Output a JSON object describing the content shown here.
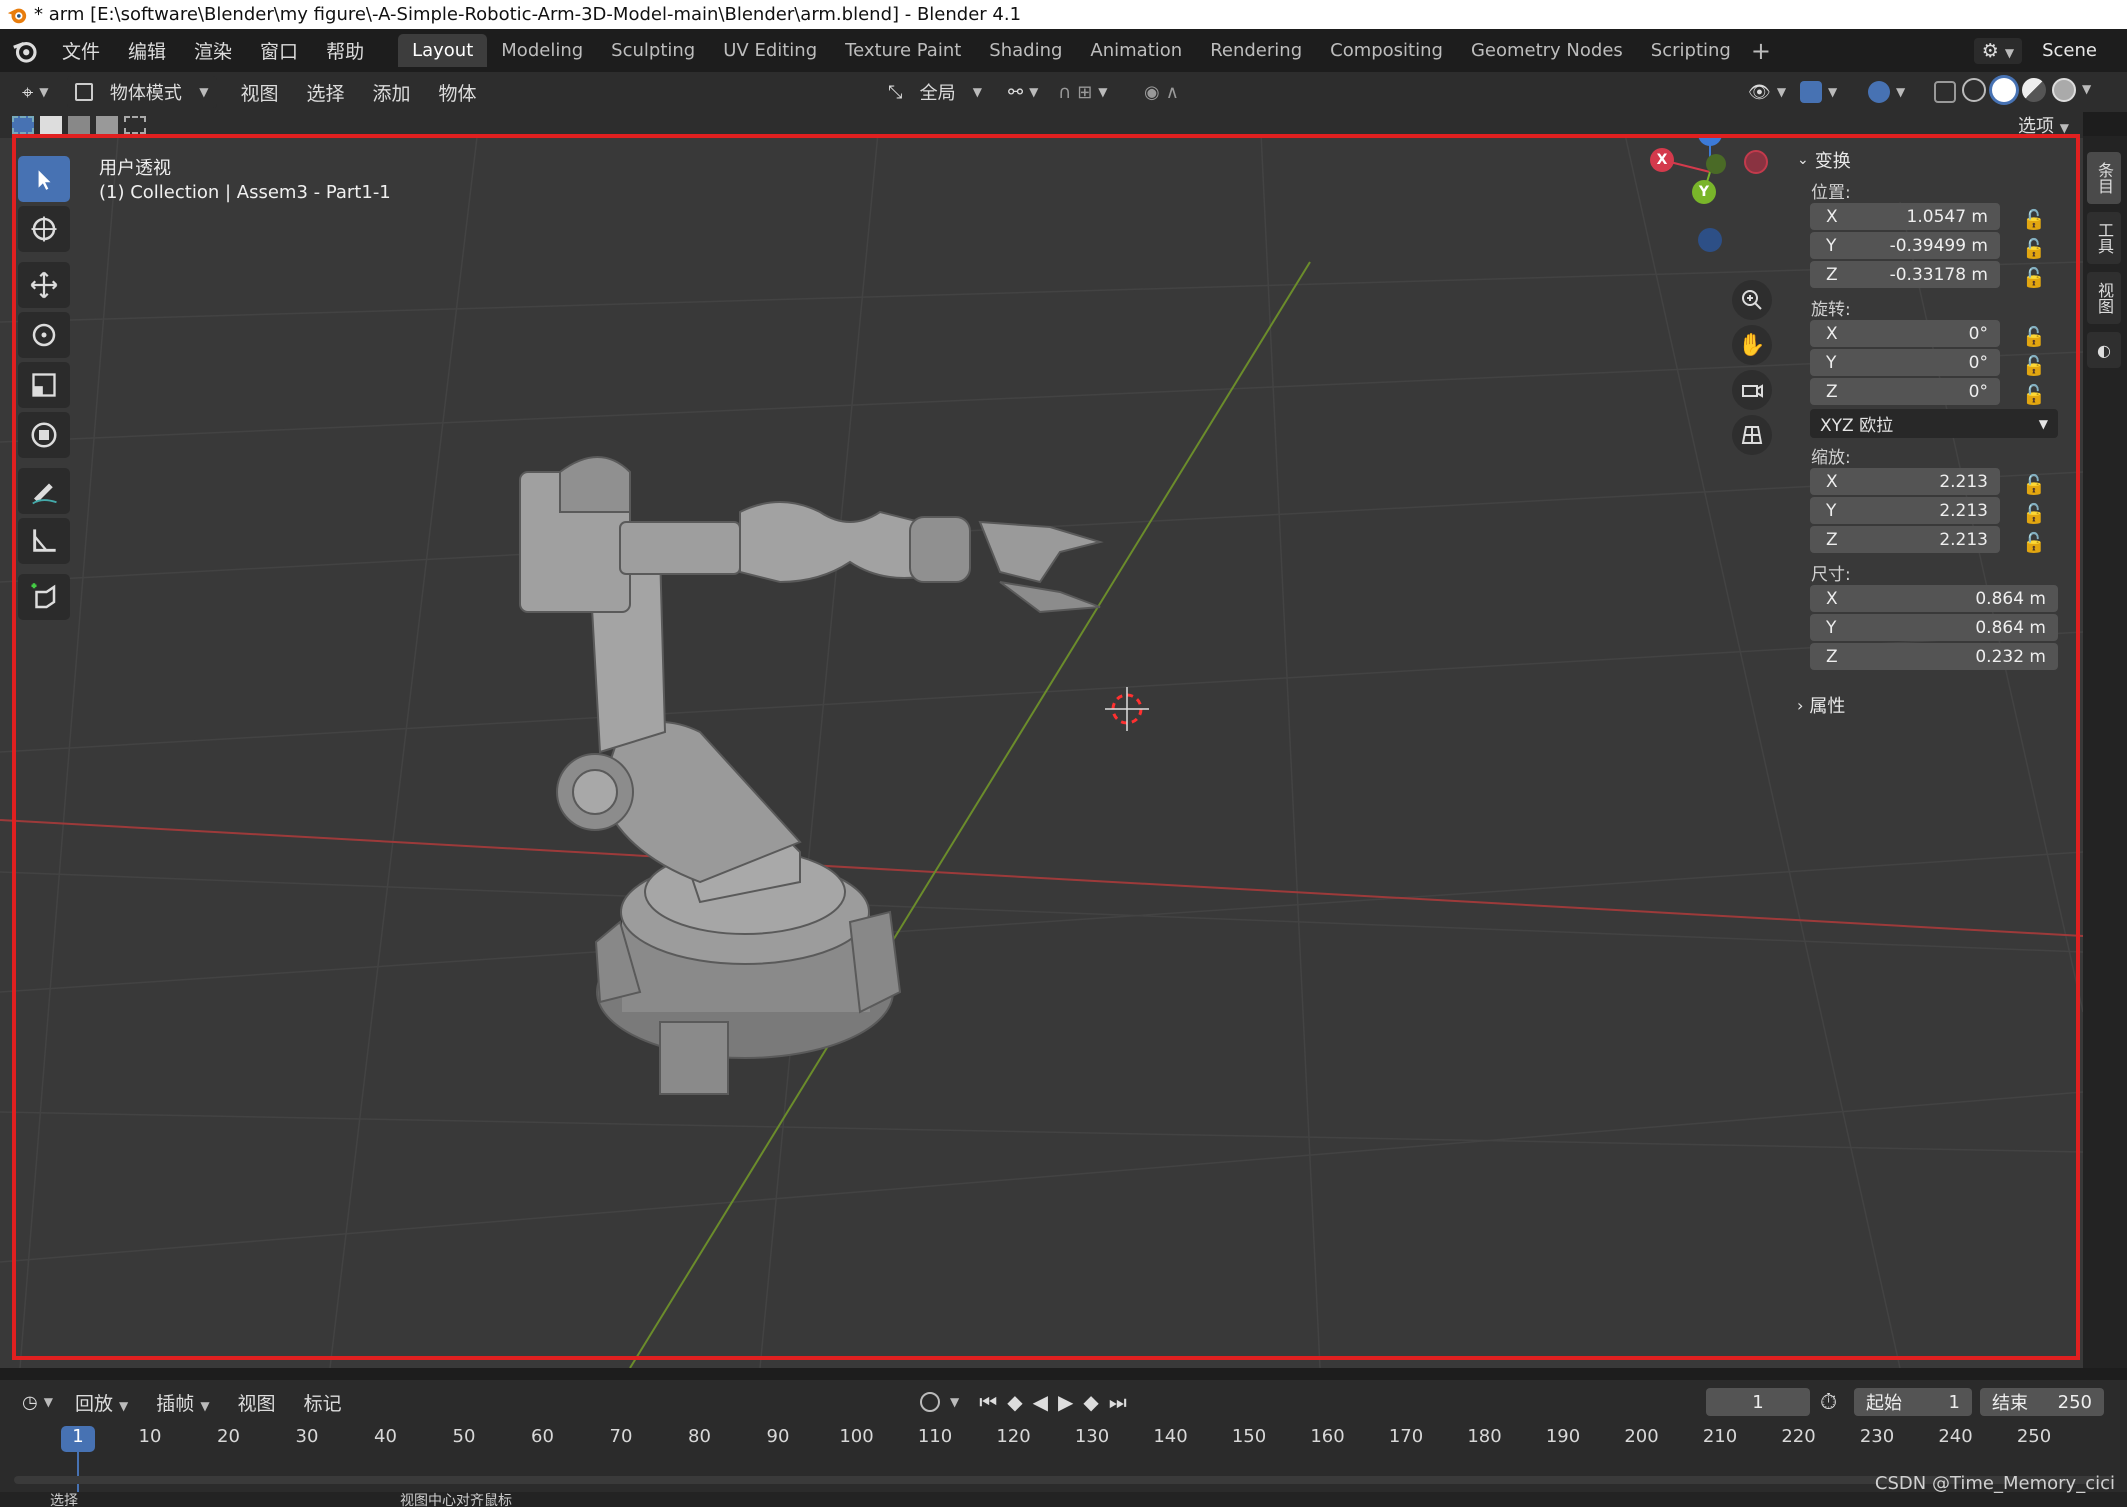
{
  "window": {
    "title": "* arm [E:\\software\\Blender\\my figure\\-A-Simple-Robotic-Arm-3D-Model-main\\Blender\\arm.blend] - Blender 4.1"
  },
  "menu": [
    "文件",
    "编辑",
    "渲染",
    "窗口",
    "帮助"
  ],
  "workspaces": [
    "Layout",
    "Modeling",
    "Sculpting",
    "UV Editing",
    "Texture Paint",
    "Shading",
    "Animation",
    "Rendering",
    "Compositing",
    "Geometry Nodes",
    "Scripting"
  ],
  "active_workspace": "Layout",
  "scene": {
    "name": "Scene"
  },
  "header": {
    "mode": "物体模式",
    "menus": [
      "视图",
      "选择",
      "添加",
      "物体"
    ],
    "orientation": "全局",
    "options": "选项"
  },
  "viewport": {
    "view_name": "用户透视",
    "collection_info": "(1) Collection | Assem3 - Part1-1",
    "gizmo": {
      "x": "X",
      "y": "Y",
      "z": "Z"
    }
  },
  "npanel": {
    "transform_title": "变换",
    "location_label": "位置:",
    "location": [
      {
        "axis": "X",
        "value": "1.0547 m"
      },
      {
        "axis": "Y",
        "value": "-0.39499 m"
      },
      {
        "axis": "Z",
        "value": "-0.33178 m"
      }
    ],
    "rotation_label": "旋转:",
    "rotation": [
      {
        "axis": "X",
        "value": "0°"
      },
      {
        "axis": "Y",
        "value": "0°"
      },
      {
        "axis": "Z",
        "value": "0°"
      }
    ],
    "rotation_mode": "XYZ 欧拉",
    "scale_label": "缩放:",
    "scale": [
      {
        "axis": "X",
        "value": "2.213"
      },
      {
        "axis": "Y",
        "value": "2.213"
      },
      {
        "axis": "Z",
        "value": "2.213"
      }
    ],
    "dimensions_label": "尺寸:",
    "dimensions": [
      {
        "axis": "X",
        "value": "0.864 m"
      },
      {
        "axis": "Y",
        "value": "0.864 m"
      },
      {
        "axis": "Z",
        "value": "0.232 m"
      }
    ],
    "properties_title": "属性",
    "tabs": [
      "条目",
      "工具",
      "视图"
    ]
  },
  "timeline": {
    "menus": [
      "回放",
      "插帧",
      "视图",
      "标记"
    ],
    "current_frame": "1",
    "start_label": "起始",
    "start": "1",
    "end_label": "结束",
    "end": "250",
    "ticks": [
      "1",
      "10",
      "20",
      "30",
      "40",
      "50",
      "60",
      "70",
      "80",
      "90",
      "100",
      "110",
      "120",
      "130",
      "140",
      "150",
      "160",
      "170",
      "180",
      "190",
      "200",
      "210",
      "220",
      "230",
      "240",
      "250"
    ]
  },
  "statusbar": {
    "left": "选择",
    "middle": "视图中心对齐鼠标"
  },
  "watermark": "CSDN @Time_Memory_cici"
}
